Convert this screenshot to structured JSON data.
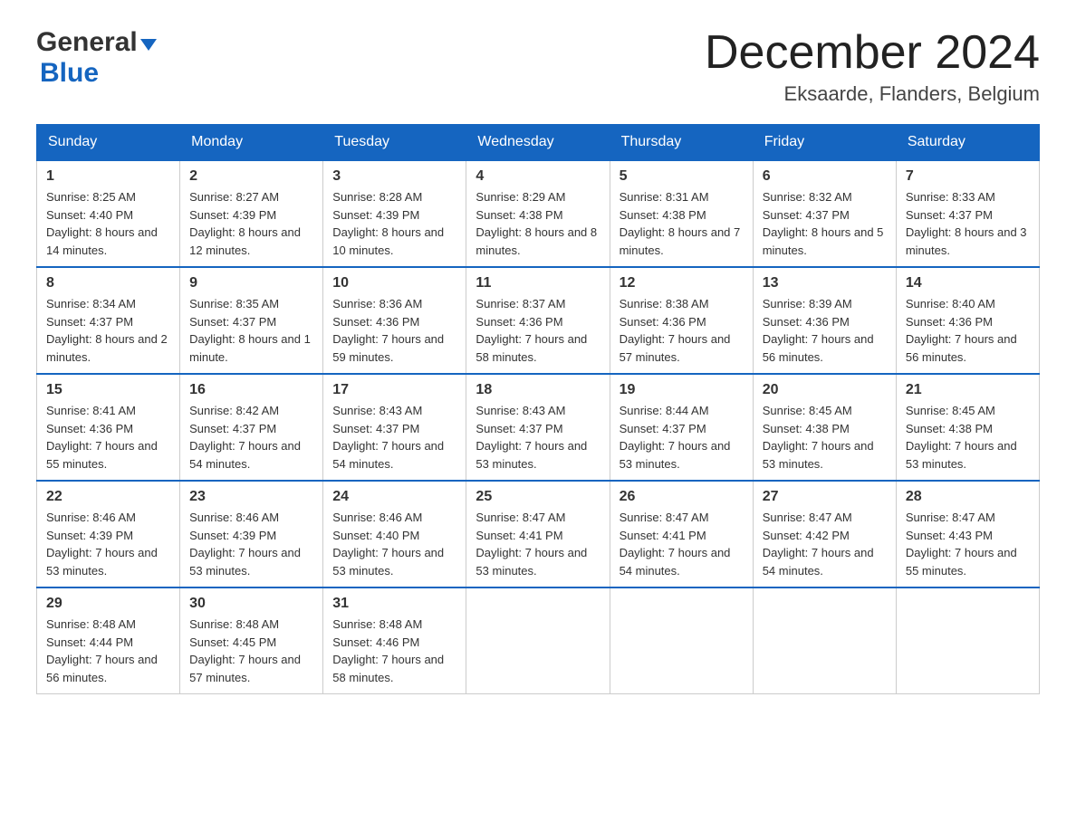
{
  "header": {
    "logo_line1": "General",
    "logo_line2": "Blue",
    "month_title": "December 2024",
    "location": "Eksaarde, Flanders, Belgium"
  },
  "days_of_week": [
    "Sunday",
    "Monday",
    "Tuesday",
    "Wednesday",
    "Thursday",
    "Friday",
    "Saturday"
  ],
  "weeks": [
    [
      {
        "day": "1",
        "sunrise": "8:25 AM",
        "sunset": "4:40 PM",
        "daylight": "8 hours and 14 minutes."
      },
      {
        "day": "2",
        "sunrise": "8:27 AM",
        "sunset": "4:39 PM",
        "daylight": "8 hours and 12 minutes."
      },
      {
        "day": "3",
        "sunrise": "8:28 AM",
        "sunset": "4:39 PM",
        "daylight": "8 hours and 10 minutes."
      },
      {
        "day": "4",
        "sunrise": "8:29 AM",
        "sunset": "4:38 PM",
        "daylight": "8 hours and 8 minutes."
      },
      {
        "day": "5",
        "sunrise": "8:31 AM",
        "sunset": "4:38 PM",
        "daylight": "8 hours and 7 minutes."
      },
      {
        "day": "6",
        "sunrise": "8:32 AM",
        "sunset": "4:37 PM",
        "daylight": "8 hours and 5 minutes."
      },
      {
        "day": "7",
        "sunrise": "8:33 AM",
        "sunset": "4:37 PM",
        "daylight": "8 hours and 3 minutes."
      }
    ],
    [
      {
        "day": "8",
        "sunrise": "8:34 AM",
        "sunset": "4:37 PM",
        "daylight": "8 hours and 2 minutes."
      },
      {
        "day": "9",
        "sunrise": "8:35 AM",
        "sunset": "4:37 PM",
        "daylight": "8 hours and 1 minute."
      },
      {
        "day": "10",
        "sunrise": "8:36 AM",
        "sunset": "4:36 PM",
        "daylight": "7 hours and 59 minutes."
      },
      {
        "day": "11",
        "sunrise": "8:37 AM",
        "sunset": "4:36 PM",
        "daylight": "7 hours and 58 minutes."
      },
      {
        "day": "12",
        "sunrise": "8:38 AM",
        "sunset": "4:36 PM",
        "daylight": "7 hours and 57 minutes."
      },
      {
        "day": "13",
        "sunrise": "8:39 AM",
        "sunset": "4:36 PM",
        "daylight": "7 hours and 56 minutes."
      },
      {
        "day": "14",
        "sunrise": "8:40 AM",
        "sunset": "4:36 PM",
        "daylight": "7 hours and 56 minutes."
      }
    ],
    [
      {
        "day": "15",
        "sunrise": "8:41 AM",
        "sunset": "4:36 PM",
        "daylight": "7 hours and 55 minutes."
      },
      {
        "day": "16",
        "sunrise": "8:42 AM",
        "sunset": "4:37 PM",
        "daylight": "7 hours and 54 minutes."
      },
      {
        "day": "17",
        "sunrise": "8:43 AM",
        "sunset": "4:37 PM",
        "daylight": "7 hours and 54 minutes."
      },
      {
        "day": "18",
        "sunrise": "8:43 AM",
        "sunset": "4:37 PM",
        "daylight": "7 hours and 53 minutes."
      },
      {
        "day": "19",
        "sunrise": "8:44 AM",
        "sunset": "4:37 PM",
        "daylight": "7 hours and 53 minutes."
      },
      {
        "day": "20",
        "sunrise": "8:45 AM",
        "sunset": "4:38 PM",
        "daylight": "7 hours and 53 minutes."
      },
      {
        "day": "21",
        "sunrise": "8:45 AM",
        "sunset": "4:38 PM",
        "daylight": "7 hours and 53 minutes."
      }
    ],
    [
      {
        "day": "22",
        "sunrise": "8:46 AM",
        "sunset": "4:39 PM",
        "daylight": "7 hours and 53 minutes."
      },
      {
        "day": "23",
        "sunrise": "8:46 AM",
        "sunset": "4:39 PM",
        "daylight": "7 hours and 53 minutes."
      },
      {
        "day": "24",
        "sunrise": "8:46 AM",
        "sunset": "4:40 PM",
        "daylight": "7 hours and 53 minutes."
      },
      {
        "day": "25",
        "sunrise": "8:47 AM",
        "sunset": "4:41 PM",
        "daylight": "7 hours and 53 minutes."
      },
      {
        "day": "26",
        "sunrise": "8:47 AM",
        "sunset": "4:41 PM",
        "daylight": "7 hours and 54 minutes."
      },
      {
        "day": "27",
        "sunrise": "8:47 AM",
        "sunset": "4:42 PM",
        "daylight": "7 hours and 54 minutes."
      },
      {
        "day": "28",
        "sunrise": "8:47 AM",
        "sunset": "4:43 PM",
        "daylight": "7 hours and 55 minutes."
      }
    ],
    [
      {
        "day": "29",
        "sunrise": "8:48 AM",
        "sunset": "4:44 PM",
        "daylight": "7 hours and 56 minutes."
      },
      {
        "day": "30",
        "sunrise": "8:48 AM",
        "sunset": "4:45 PM",
        "daylight": "7 hours and 57 minutes."
      },
      {
        "day": "31",
        "sunrise": "8:48 AM",
        "sunset": "4:46 PM",
        "daylight": "7 hours and 58 minutes."
      },
      null,
      null,
      null,
      null
    ]
  ],
  "labels": {
    "sunrise": "Sunrise:",
    "sunset": "Sunset:",
    "daylight": "Daylight:"
  }
}
